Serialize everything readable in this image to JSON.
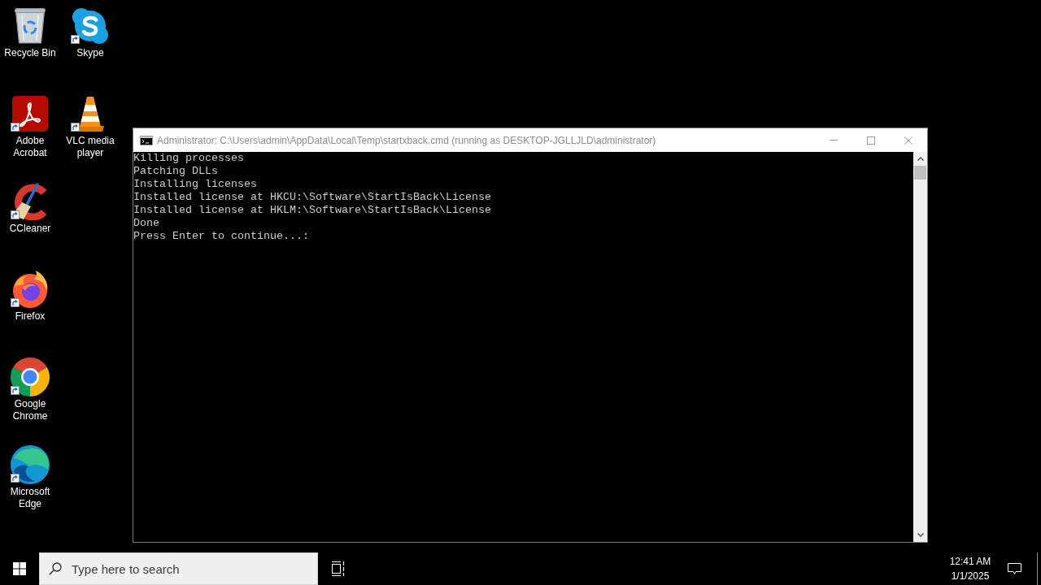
{
  "desktop": {
    "icon_columns": [
      [
        {
          "kind": "recycle",
          "label": "Recycle Bin",
          "shortcut": false
        },
        {
          "kind": "acrobat",
          "label": "Adobe Acrobat",
          "shortcut": true
        },
        {
          "kind": "ccleaner",
          "label": "CCleaner",
          "shortcut": true
        },
        {
          "kind": "firefox",
          "label": "Firefox",
          "shortcut": true
        },
        {
          "kind": "chrome",
          "label": "Google Chrome",
          "shortcut": true
        },
        {
          "kind": "edge",
          "label": "Microsoft Edge",
          "shortcut": true
        }
      ],
      [
        {
          "kind": "skype",
          "label": "Skype",
          "shortcut": true
        },
        {
          "kind": "vlc",
          "label": "VLC media player",
          "shortcut": true
        }
      ]
    ]
  },
  "console_window": {
    "title": "Administrator: C:\\Users\\admin\\AppData\\Local\\Temp\\startxback.cmd (running as DESKTOP-JGLLJLD\\administrator)",
    "active": false,
    "lines": [
      "Killing processes",
      "Patching DLLs",
      "Installing licenses",
      "Installed license at HKCU:\\Software\\StartIsBack\\License",
      "Installed license at HKLM:\\Software\\StartIsBack\\License",
      "Done",
      "Press Enter to continue...:"
    ]
  },
  "taskbar": {
    "search": {
      "placeholder": "Type here to search"
    },
    "clock": {
      "time": "12:41 AM",
      "date": "1/1/2025"
    }
  }
}
